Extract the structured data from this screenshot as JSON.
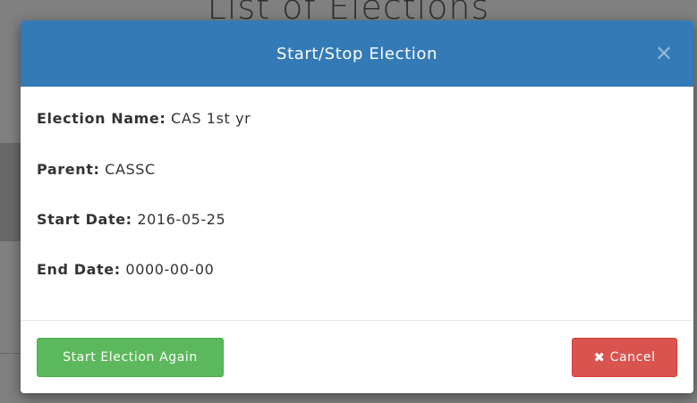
{
  "background": {
    "page_title": "List of Elections"
  },
  "modal": {
    "title": "Start/Stop Election",
    "close_icon": "close-icon",
    "fields": [
      {
        "label": "Election Name:",
        "value": "CAS 1st yr"
      },
      {
        "label": "Parent:",
        "value": "CASSC"
      },
      {
        "label": "Start Date:",
        "value": "2016-05-25"
      },
      {
        "label": "End Date:",
        "value": "0000-00-00"
      }
    ],
    "buttons": {
      "start_label": "Start Election Again",
      "cancel_label": "Cancel",
      "cancel_icon": "times-icon"
    }
  },
  "colors": {
    "header": "#337ab7",
    "start_button": "#5cb85c",
    "cancel_button": "#d9534f"
  }
}
